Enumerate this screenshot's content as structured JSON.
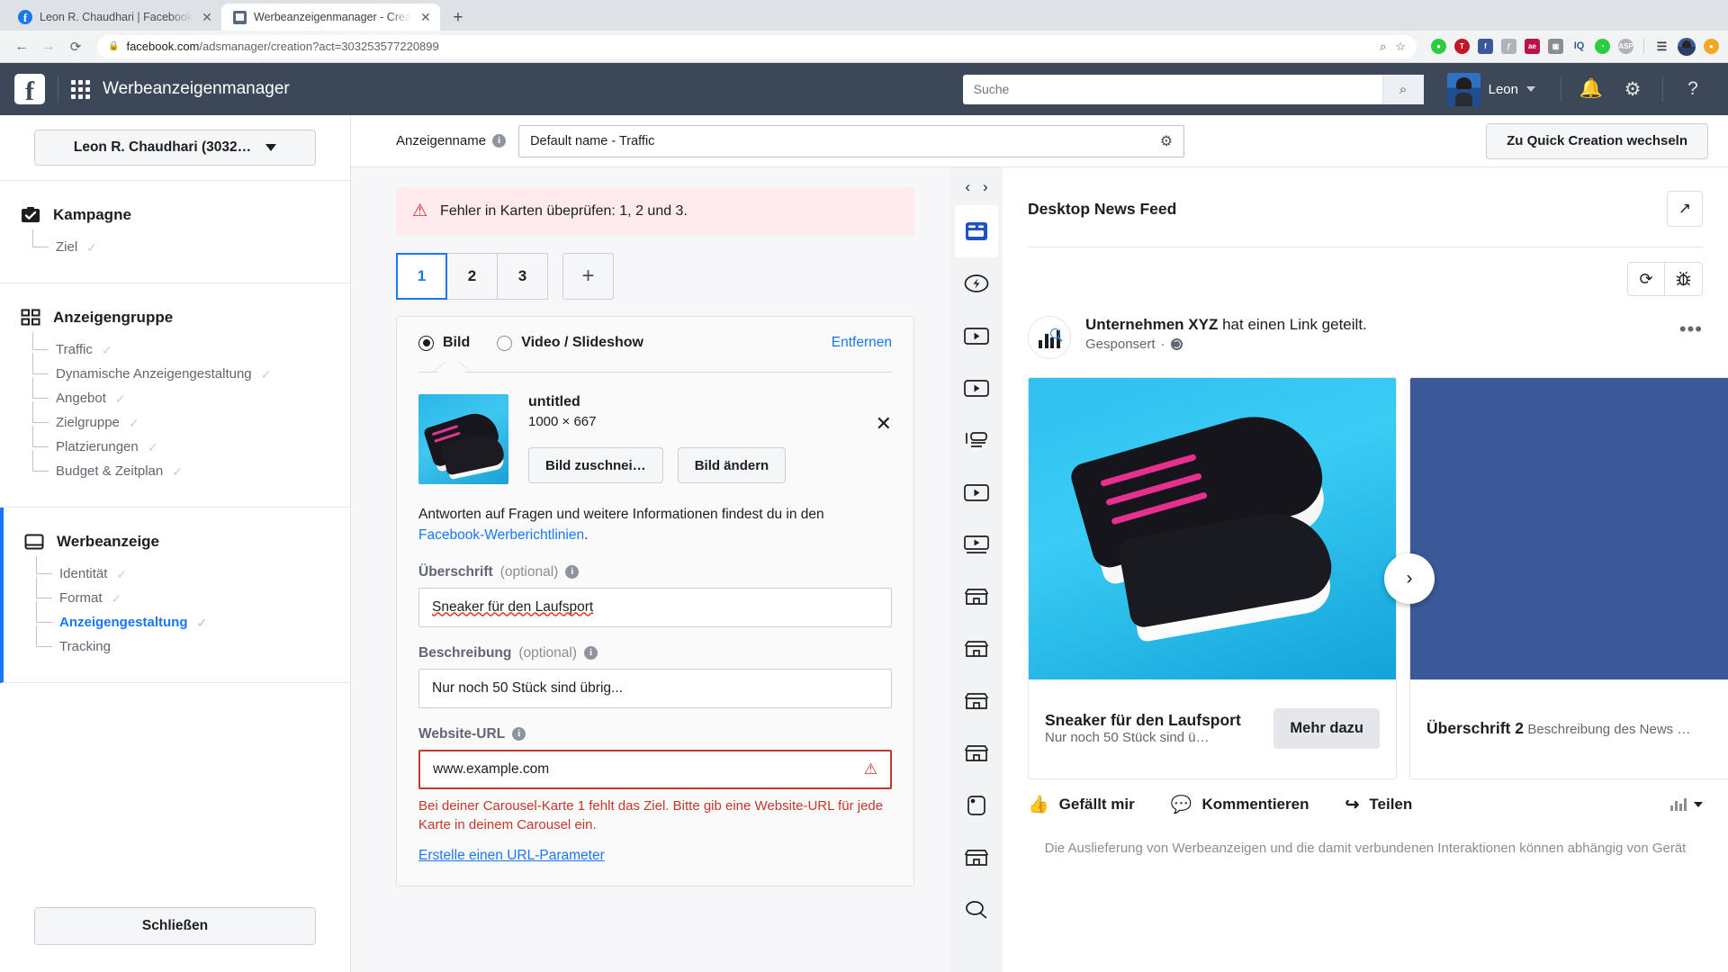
{
  "browser": {
    "tabs": [
      {
        "title": "Leon R. Chaudhari | Facebook",
        "favicon": "facebook-icon",
        "active": false
      },
      {
        "title": "Werbeanzeigenmanager - Crea",
        "favicon": "ads-manager-icon",
        "active": true
      }
    ],
    "new_tab_label": "+",
    "url_host": "facebook.com",
    "url_path": "/adsmanager/creation?act=303253577220899",
    "extensions": [
      "zoom-icon",
      "bookmark-star-icon",
      "green-shield-ext",
      "tab-red-ext",
      "facebook-ext",
      "grey-ext",
      "ae-ext",
      "pocket-ext",
      "iq-ext",
      "off-ext",
      "asp-ext",
      "list-ext",
      "profile-ext",
      "orange-ext"
    ]
  },
  "fb_header": {
    "logo": "facebook-logo",
    "apps_icon": "apps-grid-icon",
    "app_title": "Werbeanzeigenmanager",
    "search_placeholder": "Suche",
    "search_value": "",
    "search_icon": "search-icon",
    "user_name": "Leon",
    "notifications_icon": "bell-icon",
    "settings_icon": "gear-icon",
    "help_icon": "question-mark-icon"
  },
  "sidebar": {
    "account_selector": "Leon R. Chaudhari (3032…",
    "sections": [
      {
        "icon": "campaign-check-icon",
        "label": "Kampagne",
        "active": false,
        "children": [
          {
            "label": "Ziel",
            "checked": true,
            "current": false
          }
        ]
      },
      {
        "icon": "adset-grid-icon",
        "label": "Anzeigengruppe",
        "active": false,
        "children": [
          {
            "label": "Traffic",
            "checked": true,
            "current": false
          },
          {
            "label": "Dynamische Anzeigengestaltung",
            "checked": true,
            "current": false
          },
          {
            "label": "Angebot",
            "checked": true,
            "current": false
          },
          {
            "label": "Zielgruppe",
            "checked": true,
            "current": false
          },
          {
            "label": "Platzierungen",
            "checked": true,
            "current": false
          },
          {
            "label": "Budget & Zeitplan",
            "checked": true,
            "current": false
          }
        ]
      },
      {
        "icon": "ad-window-icon",
        "label": "Werbeanzeige",
        "active": true,
        "children": [
          {
            "label": "Identität",
            "checked": true,
            "current": false
          },
          {
            "label": "Format",
            "checked": true,
            "current": false
          },
          {
            "label": "Anzeigengestaltung",
            "checked": true,
            "current": true
          },
          {
            "label": "Tracking",
            "checked": false,
            "current": false
          }
        ]
      }
    ],
    "close_button": "Schließen"
  },
  "topbar": {
    "ad_name_label": "Anzeigenname",
    "ad_name_value": "Default name - Traffic",
    "ad_name_placeholder": "Anzeigenname",
    "settings_icon": "gear-icon",
    "quick_creation_button": "Zu Quick Creation wechseln"
  },
  "editor": {
    "alert": {
      "icon": "warning-triangle-icon",
      "text": "Fehler in Karten übeprüfen: 1, 2 und 3."
    },
    "card_tabs": [
      "1",
      "2",
      "3"
    ],
    "selected_card": "1",
    "add_card_label": "+",
    "media_type": {
      "options": [
        {
          "label": "Bild",
          "selected": true
        },
        {
          "label": "Video / Slideshow",
          "selected": false
        }
      ],
      "remove_link": "Entfernen"
    },
    "media": {
      "name": "untitled",
      "dimensions": "1000 × 667",
      "crop_button": "Bild zuschnei…",
      "change_button": "Bild ändern",
      "close_icon": "close-x-icon"
    },
    "hint_text_before": "Antworten auf Fragen und weitere Informationen findest du in den ",
    "hint_link": "Facebook-Werberichtlinien",
    "hint_text_after": ".",
    "fields": {
      "headline_label": "Überschrift",
      "headline_optional": "(optional)",
      "headline_value": "Sneaker für den Laufsport",
      "description_label": "Beschreibung",
      "description_optional": "(optional)",
      "description_value": "Nur noch 50 Stück sind übrig...",
      "url_label": "Website-URL",
      "url_value": "www.example.com",
      "url_error": "Bei deiner Carousel-Karte 1 fehlt das Ziel. Bitte gib eine Website-URL für jede Karte in deinem Carousel ein.",
      "url_param_link": "Erstelle einen URL-Parameter"
    }
  },
  "preview": {
    "rail_prev_icon": "chevron-left-icon",
    "rail_next_icon": "chevron-right-icon",
    "rail_items": [
      {
        "icon": "desktop-feed-icon",
        "selected": true
      },
      {
        "icon": "instant-article-icon",
        "selected": false
      },
      {
        "icon": "in-stream-video-icon",
        "selected": false
      },
      {
        "icon": "video-feed-icon",
        "selected": false
      },
      {
        "icon": "right-column-icon",
        "selected": false
      },
      {
        "icon": "video-player-icon",
        "selected": false
      },
      {
        "icon": "video-banner-icon",
        "selected": false
      },
      {
        "icon": "marketplace-icon",
        "selected": false
      },
      {
        "icon": "marketplace-icon-2",
        "selected": false
      },
      {
        "icon": "marketplace-icon-3",
        "selected": false
      },
      {
        "icon": "marketplace-icon-4",
        "selected": false
      },
      {
        "icon": "stories-icon",
        "selected": false
      },
      {
        "icon": "marketplace-icon-5",
        "selected": false
      },
      {
        "icon": "search-results-icon",
        "selected": false
      }
    ],
    "title": "Desktop News Feed",
    "open_external_icon": "external-link-icon",
    "refresh_icon": "refresh-icon",
    "debug_icon": "bug-icon",
    "post": {
      "page_avatar_icon": "analytics-chart-icon",
      "page_name": "Unternehmen XYZ",
      "action_text": "hat einen Link geteilt.",
      "sponsored": "Gesponsert",
      "privacy_icon": "globe-icon",
      "more_icon": "more-options-icon"
    },
    "cards": [
      {
        "title": "Sneaker für den Laufsport",
        "description": "Nur noch 50 Stück sind ü…",
        "cta": "Mehr dazu",
        "image": "sneaker-photo"
      },
      {
        "title": "Überschrift 2",
        "description": "Beschreibung des News …",
        "cta": "",
        "image": "blue-placeholder"
      }
    ],
    "next_arrow_icon": "carousel-next-icon",
    "actions": [
      {
        "label": "Gefällt mir",
        "icon": "thumbs-up-icon"
      },
      {
        "label": "Kommentieren",
        "icon": "comment-icon"
      },
      {
        "label": "Teilen",
        "icon": "share-icon"
      }
    ],
    "stats_icon": "insights-icon",
    "footer_text": "Die Auslieferung von Werbeanzeigen und die damit verbundenen Interaktionen können abhängig von Gerät"
  }
}
